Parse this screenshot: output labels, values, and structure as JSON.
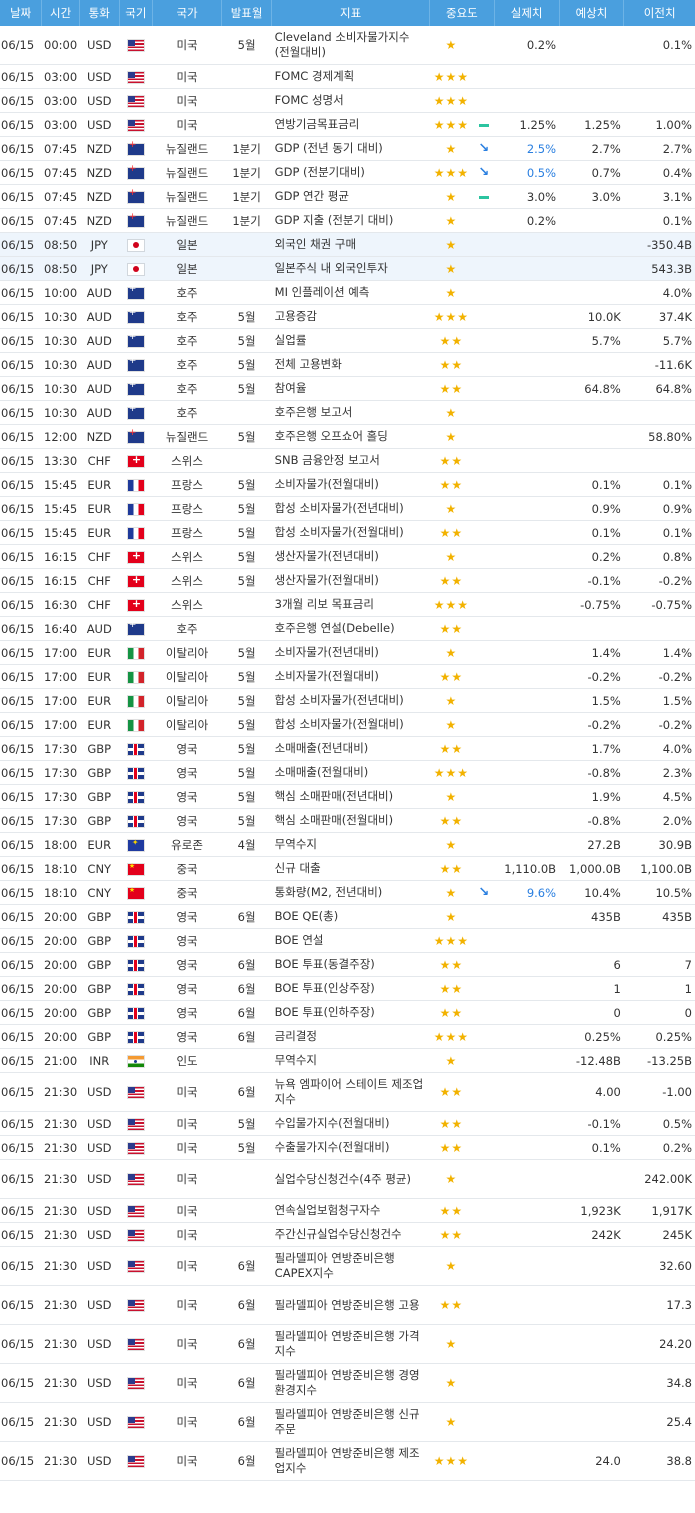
{
  "headers": {
    "date": "날짜",
    "time": "시간",
    "currency": "통화",
    "flag": "국기",
    "country": "국가",
    "period": "발표월",
    "indicator": "지표",
    "importance": "중요도",
    "actual": "실제치",
    "forecast": "예상치",
    "previous": "이전치"
  },
  "rows": [
    {
      "date": "06/15",
      "time": "00:00",
      "currency": "USD",
      "flag": "us",
      "country": "미국",
      "period": "5월",
      "indicator": "Cleveland 소비자물가지수 (전월대비)",
      "importance": "★",
      "arrow": "",
      "actual": "0.2%",
      "forecast": "",
      "previous": "0.1%",
      "tall": true
    },
    {
      "date": "06/15",
      "time": "03:00",
      "currency": "USD",
      "flag": "us",
      "country": "미국",
      "period": "",
      "indicator": "FOMC 경제계획",
      "importance": "★★★",
      "arrow": "",
      "actual": "",
      "forecast": "",
      "previous": ""
    },
    {
      "date": "06/15",
      "time": "03:00",
      "currency": "USD",
      "flag": "us",
      "country": "미국",
      "period": "",
      "indicator": "FOMC 성명서",
      "importance": "★★★",
      "arrow": "",
      "actual": "",
      "forecast": "",
      "previous": ""
    },
    {
      "date": "06/15",
      "time": "03:00",
      "currency": "USD",
      "flag": "us",
      "country": "미국",
      "period": "",
      "indicator": "연방기금목표금리",
      "importance": "★★★",
      "arrow": "flat",
      "actual": "1.25%",
      "forecast": "1.25%",
      "previous": "1.00%"
    },
    {
      "date": "06/15",
      "time": "07:45",
      "currency": "NZD",
      "flag": "nz",
      "country": "뉴질랜드",
      "period": "1분기",
      "indicator": "GDP (전년 동기 대비)",
      "importance": "★",
      "arrow": "down",
      "actual": "2.5%",
      "forecast": "2.7%",
      "previous": "2.7%"
    },
    {
      "date": "06/15",
      "time": "07:45",
      "currency": "NZD",
      "flag": "nz",
      "country": "뉴질랜드",
      "period": "1분기",
      "indicator": "GDP (전분기대비)",
      "importance": "★★★",
      "arrow": "down",
      "actual": "0.5%",
      "forecast": "0.7%",
      "previous": "0.4%"
    },
    {
      "date": "06/15",
      "time": "07:45",
      "currency": "NZD",
      "flag": "nz",
      "country": "뉴질랜드",
      "period": "1분기",
      "indicator": "GDP 연간 평균",
      "importance": "★",
      "arrow": "flat",
      "actual": "3.0%",
      "forecast": "3.0%",
      "previous": "3.1%"
    },
    {
      "date": "06/15",
      "time": "07:45",
      "currency": "NZD",
      "flag": "nz",
      "country": "뉴질랜드",
      "period": "1분기",
      "indicator": "GDP 지출 (전분기 대비)",
      "importance": "★",
      "arrow": "",
      "actual": "0.2%",
      "forecast": "",
      "previous": "0.1%"
    },
    {
      "date": "06/15",
      "time": "08:50",
      "currency": "JPY",
      "flag": "jp",
      "country": "일본",
      "period": "",
      "indicator": "외국인 채권 구매",
      "importance": "★",
      "arrow": "",
      "actual": "",
      "forecast": "",
      "previous": "-350.4B",
      "hl": true
    },
    {
      "date": "06/15",
      "time": "08:50",
      "currency": "JPY",
      "flag": "jp",
      "country": "일본",
      "period": "",
      "indicator": "일본주식 내 외국인투자",
      "importance": "★",
      "arrow": "",
      "actual": "",
      "forecast": "",
      "previous": "543.3B",
      "hl": true
    },
    {
      "date": "06/15",
      "time": "10:00",
      "currency": "AUD",
      "flag": "au",
      "country": "호주",
      "period": "",
      "indicator": "MI 인플레이션 예측",
      "importance": "★",
      "arrow": "",
      "actual": "",
      "forecast": "",
      "previous": "4.0%"
    },
    {
      "date": "06/15",
      "time": "10:30",
      "currency": "AUD",
      "flag": "au",
      "country": "호주",
      "period": "5월",
      "indicator": "고용증감",
      "importance": "★★★",
      "arrow": "",
      "actual": "",
      "forecast": "10.0K",
      "previous": "37.4K"
    },
    {
      "date": "06/15",
      "time": "10:30",
      "currency": "AUD",
      "flag": "au",
      "country": "호주",
      "period": "5월",
      "indicator": "실업률",
      "importance": "★★",
      "arrow": "",
      "actual": "",
      "forecast": "5.7%",
      "previous": "5.7%"
    },
    {
      "date": "06/15",
      "time": "10:30",
      "currency": "AUD",
      "flag": "au",
      "country": "호주",
      "period": "5월",
      "indicator": "전체 고용변화",
      "importance": "★★",
      "arrow": "",
      "actual": "",
      "forecast": "",
      "previous": "-11.6K"
    },
    {
      "date": "06/15",
      "time": "10:30",
      "currency": "AUD",
      "flag": "au",
      "country": "호주",
      "period": "5월",
      "indicator": "참여율",
      "importance": "★★",
      "arrow": "",
      "actual": "",
      "forecast": "64.8%",
      "previous": "64.8%"
    },
    {
      "date": "06/15",
      "time": "10:30",
      "currency": "AUD",
      "flag": "au",
      "country": "호주",
      "period": "",
      "indicator": "호주은행 보고서",
      "importance": "★",
      "arrow": "",
      "actual": "",
      "forecast": "",
      "previous": ""
    },
    {
      "date": "06/15",
      "time": "12:00",
      "currency": "NZD",
      "flag": "nz",
      "country": "뉴질랜드",
      "period": "5월",
      "indicator": "호주은행 오프쇼어 홀딩",
      "importance": "★",
      "arrow": "",
      "actual": "",
      "forecast": "",
      "previous": "58.80%"
    },
    {
      "date": "06/15",
      "time": "13:30",
      "currency": "CHF",
      "flag": "ch",
      "country": "스위스",
      "period": "",
      "indicator": "SNB 금융안정 보고서",
      "importance": "★★",
      "arrow": "",
      "actual": "",
      "forecast": "",
      "previous": ""
    },
    {
      "date": "06/15",
      "time": "15:45",
      "currency": "EUR",
      "flag": "fr",
      "country": "프랑스",
      "period": "5월",
      "indicator": "소비자물가(전월대비)",
      "importance": "★★",
      "arrow": "",
      "actual": "",
      "forecast": "0.1%",
      "previous": "0.1%"
    },
    {
      "date": "06/15",
      "time": "15:45",
      "currency": "EUR",
      "flag": "fr",
      "country": "프랑스",
      "period": "5월",
      "indicator": "합성 소비자물가(전년대비)",
      "importance": "★",
      "arrow": "",
      "actual": "",
      "forecast": "0.9%",
      "previous": "0.9%"
    },
    {
      "date": "06/15",
      "time": "15:45",
      "currency": "EUR",
      "flag": "fr",
      "country": "프랑스",
      "period": "5월",
      "indicator": "합성 소비자물가(전월대비)",
      "importance": "★★",
      "arrow": "",
      "actual": "",
      "forecast": "0.1%",
      "previous": "0.1%"
    },
    {
      "date": "06/15",
      "time": "16:15",
      "currency": "CHF",
      "flag": "ch",
      "country": "스위스",
      "period": "5월",
      "indicator": "생산자물가(전년대비)",
      "importance": "★",
      "arrow": "",
      "actual": "",
      "forecast": "0.2%",
      "previous": "0.8%"
    },
    {
      "date": "06/15",
      "time": "16:15",
      "currency": "CHF",
      "flag": "ch",
      "country": "스위스",
      "period": "5월",
      "indicator": "생산자물가(전월대비)",
      "importance": "★★",
      "arrow": "",
      "actual": "",
      "forecast": "-0.1%",
      "previous": "-0.2%"
    },
    {
      "date": "06/15",
      "time": "16:30",
      "currency": "CHF",
      "flag": "ch",
      "country": "스위스",
      "period": "",
      "indicator": "3개월 리보 목표금리",
      "importance": "★★★",
      "arrow": "",
      "actual": "",
      "forecast": "-0.75%",
      "previous": "-0.75%"
    },
    {
      "date": "06/15",
      "time": "16:40",
      "currency": "AUD",
      "flag": "au",
      "country": "호주",
      "period": "",
      "indicator": "호주은행 연설(Debelle)",
      "importance": "★★",
      "arrow": "",
      "actual": "",
      "forecast": "",
      "previous": ""
    },
    {
      "date": "06/15",
      "time": "17:00",
      "currency": "EUR",
      "flag": "it",
      "country": "이탈리아",
      "period": "5월",
      "indicator": "소비자물가(전년대비)",
      "importance": "★",
      "arrow": "",
      "actual": "",
      "forecast": "1.4%",
      "previous": "1.4%"
    },
    {
      "date": "06/15",
      "time": "17:00",
      "currency": "EUR",
      "flag": "it",
      "country": "이탈리아",
      "period": "5월",
      "indicator": "소비자물가(전월대비)",
      "importance": "★★",
      "arrow": "",
      "actual": "",
      "forecast": "-0.2%",
      "previous": "-0.2%"
    },
    {
      "date": "06/15",
      "time": "17:00",
      "currency": "EUR",
      "flag": "it",
      "country": "이탈리아",
      "period": "5월",
      "indicator": "합성 소비자물가(전년대비)",
      "importance": "★",
      "arrow": "",
      "actual": "",
      "forecast": "1.5%",
      "previous": "1.5%"
    },
    {
      "date": "06/15",
      "time": "17:00",
      "currency": "EUR",
      "flag": "it",
      "country": "이탈리아",
      "period": "5월",
      "indicator": "합성 소비자물가(전월대비)",
      "importance": "★",
      "arrow": "",
      "actual": "",
      "forecast": "-0.2%",
      "previous": "-0.2%"
    },
    {
      "date": "06/15",
      "time": "17:30",
      "currency": "GBP",
      "flag": "gb",
      "country": "영국",
      "period": "5월",
      "indicator": "소매매출(전년대비)",
      "importance": "★★",
      "arrow": "",
      "actual": "",
      "forecast": "1.7%",
      "previous": "4.0%"
    },
    {
      "date": "06/15",
      "time": "17:30",
      "currency": "GBP",
      "flag": "gb",
      "country": "영국",
      "period": "5월",
      "indicator": "소매매출(전월대비)",
      "importance": "★★★",
      "arrow": "",
      "actual": "",
      "forecast": "-0.8%",
      "previous": "2.3%"
    },
    {
      "date": "06/15",
      "time": "17:30",
      "currency": "GBP",
      "flag": "gb",
      "country": "영국",
      "period": "5월",
      "indicator": "핵심 소매판매(전년대비)",
      "importance": "★",
      "arrow": "",
      "actual": "",
      "forecast": "1.9%",
      "previous": "4.5%"
    },
    {
      "date": "06/15",
      "time": "17:30",
      "currency": "GBP",
      "flag": "gb",
      "country": "영국",
      "period": "5월",
      "indicator": "핵심 소매판매(전월대비)",
      "importance": "★★",
      "arrow": "",
      "actual": "",
      "forecast": "-0.8%",
      "previous": "2.0%"
    },
    {
      "date": "06/15",
      "time": "18:00",
      "currency": "EUR",
      "flag": "eu",
      "country": "유로존",
      "period": "4월",
      "indicator": "무역수지",
      "importance": "★",
      "arrow": "",
      "actual": "",
      "forecast": "27.2B",
      "previous": "30.9B"
    },
    {
      "date": "06/15",
      "time": "18:10",
      "currency": "CNY",
      "flag": "cn",
      "country": "중국",
      "period": "",
      "indicator": "신규 대출",
      "importance": "★★",
      "arrow": "",
      "actual": "1,110.0B",
      "forecast": "1,000.0B",
      "previous": "1,100.0B"
    },
    {
      "date": "06/15",
      "time": "18:10",
      "currency": "CNY",
      "flag": "cn",
      "country": "중국",
      "period": "",
      "indicator": "통화량(M2, 전년대비)",
      "importance": "★",
      "arrow": "down",
      "actual": "9.6%",
      "forecast": "10.4%",
      "previous": "10.5%"
    },
    {
      "date": "06/15",
      "time": "20:00",
      "currency": "GBP",
      "flag": "gb",
      "country": "영국",
      "period": "6월",
      "indicator": "BOE QE(총)",
      "importance": "★",
      "arrow": "",
      "actual": "",
      "forecast": "435B",
      "previous": "435B"
    },
    {
      "date": "06/15",
      "time": "20:00",
      "currency": "GBP",
      "flag": "gb",
      "country": "영국",
      "period": "",
      "indicator": "BOE 연설",
      "importance": "★★★",
      "arrow": "",
      "actual": "",
      "forecast": "",
      "previous": ""
    },
    {
      "date": "06/15",
      "time": "20:00",
      "currency": "GBP",
      "flag": "gb",
      "country": "영국",
      "period": "6월",
      "indicator": "BOE 투표(동결주장)",
      "importance": "★★",
      "arrow": "",
      "actual": "",
      "forecast": "6",
      "previous": "7"
    },
    {
      "date": "06/15",
      "time": "20:00",
      "currency": "GBP",
      "flag": "gb",
      "country": "영국",
      "period": "6월",
      "indicator": "BOE 투표(인상주장)",
      "importance": "★★",
      "arrow": "",
      "actual": "",
      "forecast": "1",
      "previous": "1"
    },
    {
      "date": "06/15",
      "time": "20:00",
      "currency": "GBP",
      "flag": "gb",
      "country": "영국",
      "period": "6월",
      "indicator": "BOE 투표(인하주장)",
      "importance": "★★",
      "arrow": "",
      "actual": "",
      "forecast": "0",
      "previous": "0"
    },
    {
      "date": "06/15",
      "time": "20:00",
      "currency": "GBP",
      "flag": "gb",
      "country": "영국",
      "period": "6월",
      "indicator": "금리결정",
      "importance": "★★★",
      "arrow": "",
      "actual": "",
      "forecast": "0.25%",
      "previous": "0.25%"
    },
    {
      "date": "06/15",
      "time": "21:00",
      "currency": "INR",
      "flag": "in",
      "country": "인도",
      "period": "",
      "indicator": "무역수지",
      "importance": "★",
      "arrow": "",
      "actual": "",
      "forecast": "-12.48B",
      "previous": "-13.25B"
    },
    {
      "date": "06/15",
      "time": "21:30",
      "currency": "USD",
      "flag": "us",
      "country": "미국",
      "period": "6월",
      "indicator": "뉴욕 엠파이어 스테이트 제조업 지수",
      "importance": "★★",
      "arrow": "",
      "actual": "",
      "forecast": "4.00",
      "previous": "-1.00",
      "tall": true
    },
    {
      "date": "06/15",
      "time": "21:30",
      "currency": "USD",
      "flag": "us",
      "country": "미국",
      "period": "5월",
      "indicator": "수입물가지수(전월대비)",
      "importance": "★★",
      "arrow": "",
      "actual": "",
      "forecast": "-0.1%",
      "previous": "0.5%"
    },
    {
      "date": "06/15",
      "time": "21:30",
      "currency": "USD",
      "flag": "us",
      "country": "미국",
      "period": "5월",
      "indicator": "수출물가지수(전월대비)",
      "importance": "★★",
      "arrow": "",
      "actual": "",
      "forecast": "0.1%",
      "previous": "0.2%"
    },
    {
      "date": "06/15",
      "time": "21:30",
      "currency": "USD",
      "flag": "us",
      "country": "미국",
      "period": "",
      "indicator": "실업수당신청건수(4주 평균)",
      "importance": "★",
      "arrow": "",
      "actual": "",
      "forecast": "",
      "previous": "242.00K",
      "tall": true
    },
    {
      "date": "06/15",
      "time": "21:30",
      "currency": "USD",
      "flag": "us",
      "country": "미국",
      "period": "",
      "indicator": "연속실업보험청구자수",
      "importance": "★★",
      "arrow": "",
      "actual": "",
      "forecast": "1,923K",
      "previous": "1,917K"
    },
    {
      "date": "06/15",
      "time": "21:30",
      "currency": "USD",
      "flag": "us",
      "country": "미국",
      "period": "",
      "indicator": "주간신규실업수당신청건수",
      "importance": "★★",
      "arrow": "",
      "actual": "",
      "forecast": "242K",
      "previous": "245K"
    },
    {
      "date": "06/15",
      "time": "21:30",
      "currency": "USD",
      "flag": "us",
      "country": "미국",
      "period": "6월",
      "indicator": "필라델피아 연방준비은행 CAPEX지수",
      "importance": "★",
      "arrow": "",
      "actual": "",
      "forecast": "",
      "previous": "32.60",
      "tall": true
    },
    {
      "date": "06/15",
      "time": "21:30",
      "currency": "USD",
      "flag": "us",
      "country": "미국",
      "period": "6월",
      "indicator": "필라델피아 연방준비은행 고용",
      "importance": "★★",
      "arrow": "",
      "actual": "",
      "forecast": "",
      "previous": "17.3",
      "tall": true
    },
    {
      "date": "06/15",
      "time": "21:30",
      "currency": "USD",
      "flag": "us",
      "country": "미국",
      "period": "6월",
      "indicator": "필라델피아 연방준비은행 가격지수",
      "importance": "★",
      "arrow": "",
      "actual": "",
      "forecast": "",
      "previous": "24.20",
      "tall": true
    },
    {
      "date": "06/15",
      "time": "21:30",
      "currency": "USD",
      "flag": "us",
      "country": "미국",
      "period": "6월",
      "indicator": "필라델피아 연방준비은행 경영환경지수",
      "importance": "★",
      "arrow": "",
      "actual": "",
      "forecast": "",
      "previous": "34.8",
      "tall": true
    },
    {
      "date": "06/15",
      "time": "21:30",
      "currency": "USD",
      "flag": "us",
      "country": "미국",
      "period": "6월",
      "indicator": "필라델피아 연방준비은행 신규주문",
      "importance": "★",
      "arrow": "",
      "actual": "",
      "forecast": "",
      "previous": "25.4",
      "tall": true
    },
    {
      "date": "06/15",
      "time": "21:30",
      "currency": "USD",
      "flag": "us",
      "country": "미국",
      "period": "6월",
      "indicator": "필라델피아 연방준비은행 제조업지수",
      "importance": "★★★",
      "arrow": "",
      "actual": "",
      "forecast": "24.0",
      "previous": "38.8",
      "tall": true
    }
  ]
}
